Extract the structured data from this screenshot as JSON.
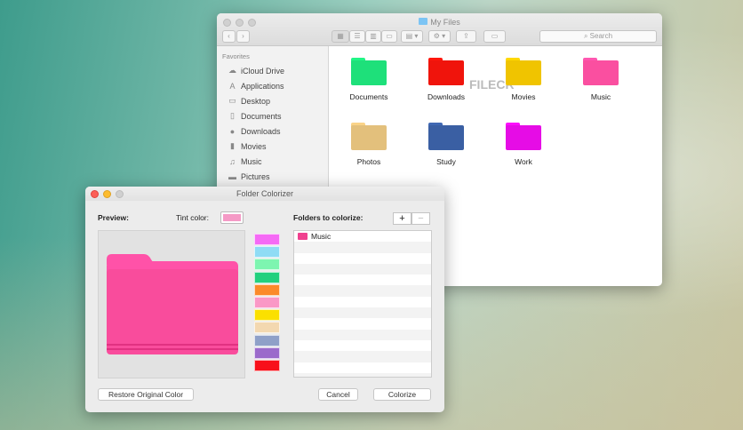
{
  "finder": {
    "title": "My Files",
    "search_placeholder": "Search",
    "sidebar": {
      "heading": "Favorites",
      "items": [
        {
          "label": "iCloud Drive",
          "icon": "cloud-icon"
        },
        {
          "label": "Applications",
          "icon": "applications-icon"
        },
        {
          "label": "Desktop",
          "icon": "desktop-icon"
        },
        {
          "label": "Documents",
          "icon": "documents-icon"
        },
        {
          "label": "Downloads",
          "icon": "downloads-icon"
        },
        {
          "label": "Movies",
          "icon": "movies-icon"
        },
        {
          "label": "Music",
          "icon": "music-icon"
        },
        {
          "label": "Pictures",
          "icon": "pictures-icon"
        }
      ]
    },
    "folders": [
      {
        "name": "Documents",
        "color": "#1ee07a"
      },
      {
        "name": "Downloads",
        "color": "#f0140c"
      },
      {
        "name": "Movies",
        "color": "#f0c400"
      },
      {
        "name": "Music",
        "color": "#fa4fa0"
      },
      {
        "name": "Photos",
        "color": "#e3c07c"
      },
      {
        "name": "Study",
        "color": "#3a5fa3"
      },
      {
        "name": "Work",
        "color": "#e60ce6"
      }
    ],
    "watermark": "FILECR"
  },
  "dialog": {
    "title": "Folder Colorizer",
    "preview_label": "Preview:",
    "tint_label": "Tint color:",
    "tint_color": "#f59ac6",
    "preview_color": "#f94c9c",
    "folders_label": "Folders to colorize:",
    "add": "+",
    "remove": "−",
    "palette": [
      "#f56af5",
      "#8fdcf5",
      "#7df5b0",
      "#22d07e",
      "#fb8a2a",
      "#fa98c6",
      "#fbe000",
      "#f3d8b0",
      "#8fa0c8",
      "#9b6acb",
      "#f8101a"
    ],
    "folders": [
      {
        "name": "Music",
        "color": "#f0418f"
      }
    ],
    "restore": "Restore Original Color",
    "cancel": "Cancel",
    "colorize": "Colorize"
  }
}
